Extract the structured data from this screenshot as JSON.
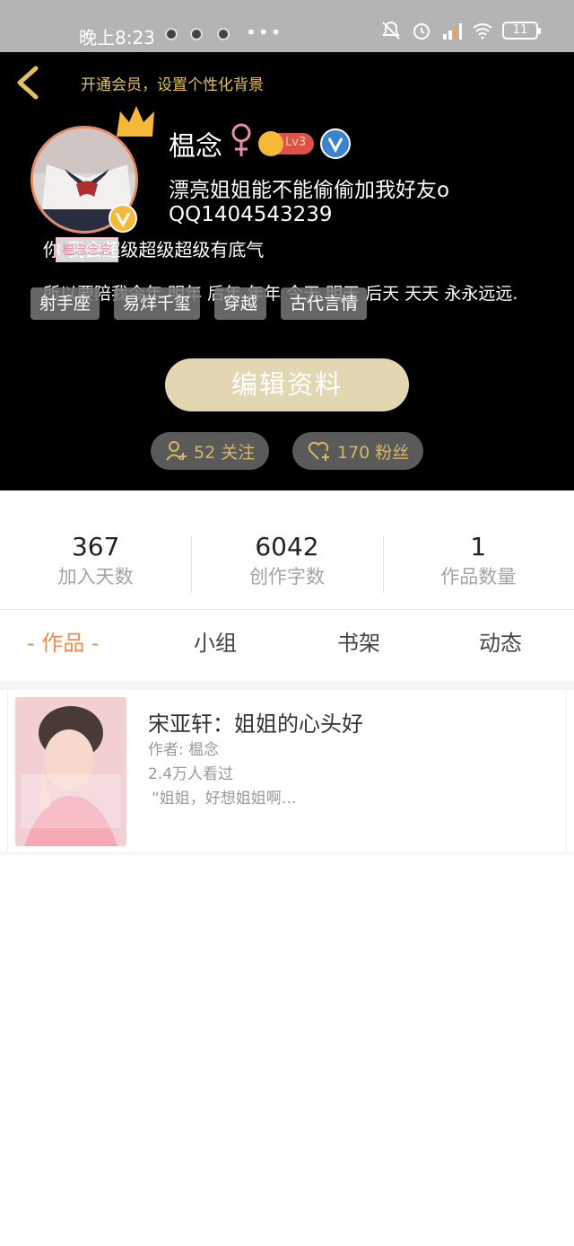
{
  "status_bar": {
    "time": "晚上8:23",
    "dots": "•••",
    "battery": "11"
  },
  "header": {
    "vip_banner": "开通会员，设置个性化背景"
  },
  "profile": {
    "name": "榅念",
    "level": "Lv3",
    "bio_line1": "漂亮姐姐能不能偷偷加我好友o",
    "qq": "QQ1404543239",
    "bio_line2": "你 我会超级超级超级有底气",
    "bio_line3": "所以要陪我今年 明年 后年 年年 今天 明天 后天 天天 永永远远.",
    "nickname_tag": "榅念念念",
    "tags": [
      "射手座",
      "易烊千玺",
      "穿越",
      "古代言情"
    ],
    "edit_label": "编辑资料",
    "follow_label": "52 关注",
    "fans_label": "170 粉丝"
  },
  "stats": [
    {
      "value": "367",
      "label": "加入天数"
    },
    {
      "value": "6042",
      "label": "创作字数"
    },
    {
      "value": "1",
      "label": "作品数量"
    }
  ],
  "tabs": [
    {
      "label": "- 作品 -",
      "active": true
    },
    {
      "label": "小组",
      "active": false
    },
    {
      "label": "书架",
      "active": false
    },
    {
      "label": "动态",
      "active": false
    }
  ],
  "works": [
    {
      "title": "宋亚轩：姐姐的心头好",
      "author": "作者: 榅念",
      "views": "2.4万人看过",
      "excerpt": "“姐姐，好想姐姐啊…"
    }
  ],
  "colors": {
    "accent_gold": "#e2c25a",
    "active_tab": "#ee8c4f",
    "edit_button": "#e3d6b2",
    "header_bg": "#000000"
  },
  "icons": {
    "back": "chevron-left-icon",
    "crown": "crown-icon",
    "gender": "female-icon",
    "verified": "verified-v-icon",
    "follow": "add-user-icon",
    "fans": "heart-plus-icon"
  }
}
